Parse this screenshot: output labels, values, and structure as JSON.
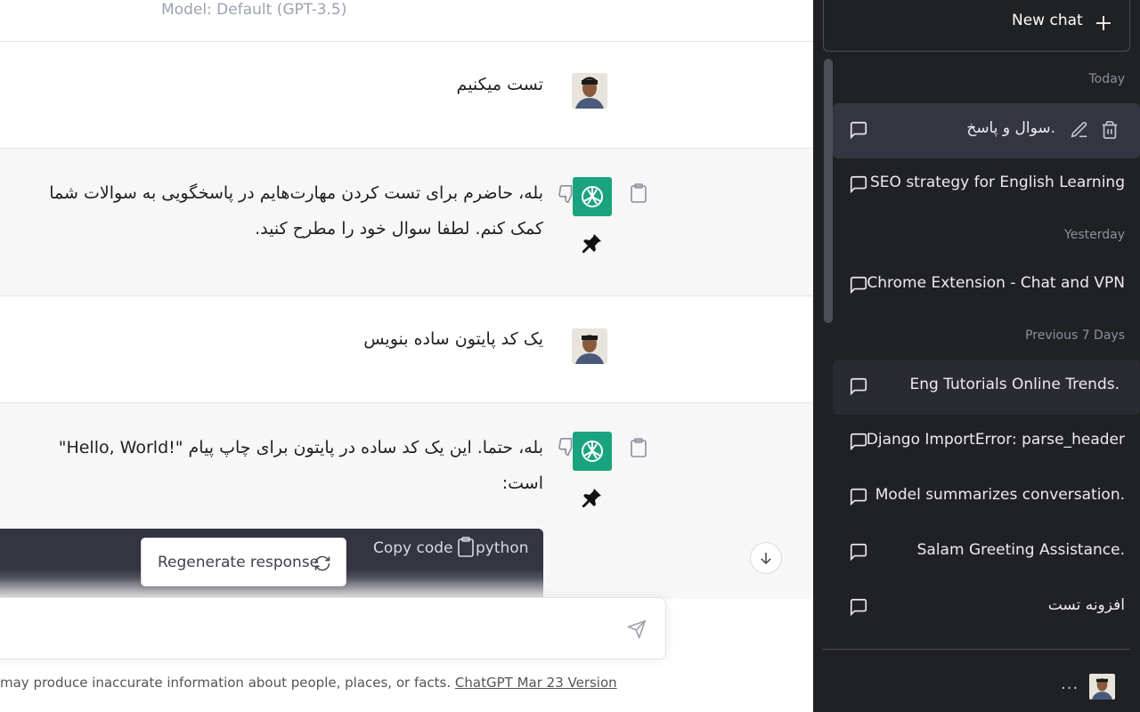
{
  "header": {
    "model_label": "Model: Default (GPT-3.5)"
  },
  "messages": [
    {
      "role": "user",
      "text": "تست میکنیم"
    },
    {
      "role": "assistant",
      "lines": [
        "بله، حاضرم برای تست کردن مهارت‌هایم در پاسخگویی به سوالات شما",
        "کمک کنم. لطفا سوال خود را مطرح کنید."
      ]
    },
    {
      "role": "user",
      "text": "یک کد پایتون ساده بنویس"
    },
    {
      "role": "assistant",
      "lines": [
        "بله، حتما. این یک کد ساده در پایتون برای چاپ پیام \"!Hello, World\"",
        "است:"
      ]
    }
  ],
  "code_block": {
    "language": "python",
    "copy_label": "Copy code"
  },
  "regenerate_label": "Regenerate response",
  "footer": {
    "note": "may produce inaccurate information about people, places, or facts.",
    "version_link": "ChatGPT Mar 23 Version"
  },
  "sidebar": {
    "new_chat_label": "New chat",
    "sections": {
      "today": "Today",
      "yesterday": "Yesterday",
      "previous_7_days": "Previous 7 Days"
    },
    "chats": [
      {
        "title": "سوال و پاسخ."
      },
      {
        "title": "SEO strategy for English Learning"
      },
      {
        "title": "Chrome Extension - Chat and VPN"
      },
      {
        "title": "Eng Tutorials Online Trends."
      },
      {
        "title": "Django ImportError: parse_header"
      },
      {
        "title": "Model summarizes conversation."
      },
      {
        "title": "Salam Greeting Assistance."
      },
      {
        "title": "افزونه تست"
      }
    ],
    "more_label": "..."
  },
  "colors": {
    "sidebar_bg": "#202123",
    "assistant_avatar": "#1aa37f",
    "active_chat_bg": "#343541"
  }
}
